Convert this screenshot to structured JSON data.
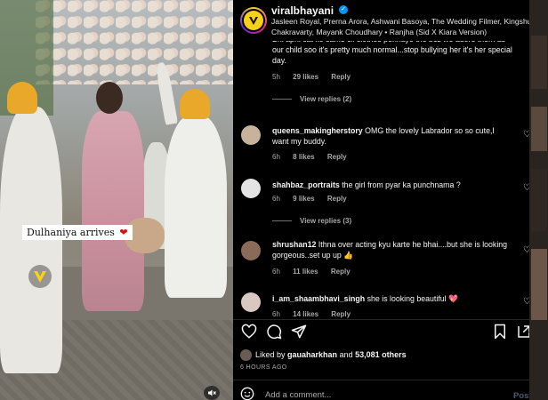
{
  "post": {
    "username": "viralbhayani",
    "verified_icon": "verified-badge-icon",
    "credits": "Jasleen Royal, Prerna Arora, Ashwani Basoya, The Wedding Filmer, Kingshuk Chakravarty, Mayank Choudhary • Ranjha (Sid X Kiara Version)"
  },
  "media": {
    "caption": "Dulhaniya arrives",
    "caption_emoji": "❤"
  },
  "comments": [
    {
      "username": "",
      "text": "Bhi apni cat ko same cll clothes pehnaye the bcz we adore them as our child soo it's pretty much normal...stop bullying her it's her special day.",
      "time": "5h",
      "likes": "29 likes",
      "reply": "Reply",
      "view_replies": "View replies (2)"
    },
    {
      "username": "queens_makingherstory",
      "text": "OMG the lovely Labrador so so cute,I want my buddy.",
      "time": "6h",
      "likes": "8 likes",
      "reply": "Reply"
    },
    {
      "username": "shahbaz_portraits",
      "text": "the girl from pyar ka punchnama ?",
      "time": "6h",
      "likes": "9 likes",
      "reply": "Reply",
      "view_replies": "View replies (3)"
    },
    {
      "username": "shrushan12",
      "text": "Ithna over acting kyu karte he bhai....but she is looking gorgeous..set up up 👍",
      "time": "6h",
      "likes": "11 likes",
      "reply": "Reply"
    },
    {
      "username": "i_am_shaambhavi_singh",
      "text": "she is looking beautiful 💖",
      "time": "6h",
      "likes": "14 likes",
      "reply": "Reply"
    }
  ],
  "footer": {
    "liked_by_user": "gauaharkhan",
    "liked_by_joiner": "and",
    "liked_by_others": "53,081 others",
    "timestamp": "6 HOURS AGO",
    "add_comment_placeholder": "Add a comment...",
    "post_label": "Post"
  },
  "colors": {
    "accent_blue": "#0095f6",
    "post_disabled": "#4a5b6d",
    "muted_text": "#a8a8a8"
  }
}
